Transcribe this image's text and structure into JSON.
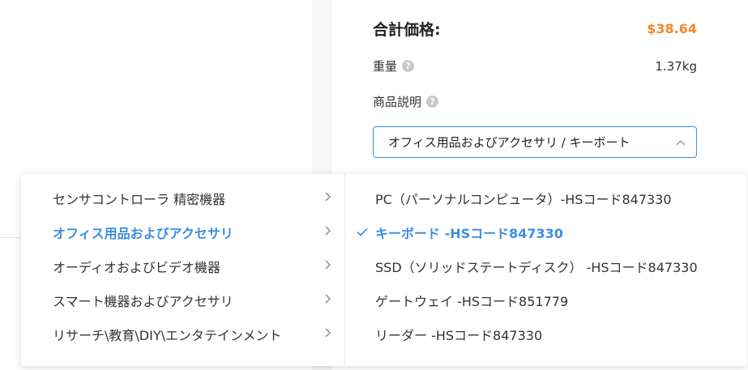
{
  "summary": {
    "total_label": "合計価格:",
    "total_value": "$38.64",
    "weight_label": "重量",
    "weight_value": "1.37kg",
    "description_label": "商品説明"
  },
  "category_select": {
    "value": "オフィス用品およびアクセサリ / キーボート"
  },
  "dropdown": {
    "categories": [
      {
        "label": "センサコントローラ 精密機器"
      },
      {
        "label": "オフィス用品およびアクセサリ"
      },
      {
        "label": "オーディオおよびビデオ機器"
      },
      {
        "label": "スマート機器およびアクセサリ"
      },
      {
        "label": "リサーチ\\教育\\DIY\\エンタテインメント"
      }
    ],
    "subitems": [
      {
        "label": "PC（パーソナルコンピュータ）-HSコード847330"
      },
      {
        "label": "キーボード -HSコード847330"
      },
      {
        "label": "SSD（ソリッドステートディスク） -HSコード847330"
      },
      {
        "label": "ゲートウェイ -HSコード851779"
      },
      {
        "label": "リーダー -HSコード847330"
      }
    ]
  },
  "colors": {
    "accent": "#3b8fe0",
    "price": "#f0882a"
  },
  "icons": {
    "help": "question-circle-icon",
    "caret": "chevron-up-icon",
    "arrow": "chevron-right-icon",
    "check": "check-icon"
  }
}
